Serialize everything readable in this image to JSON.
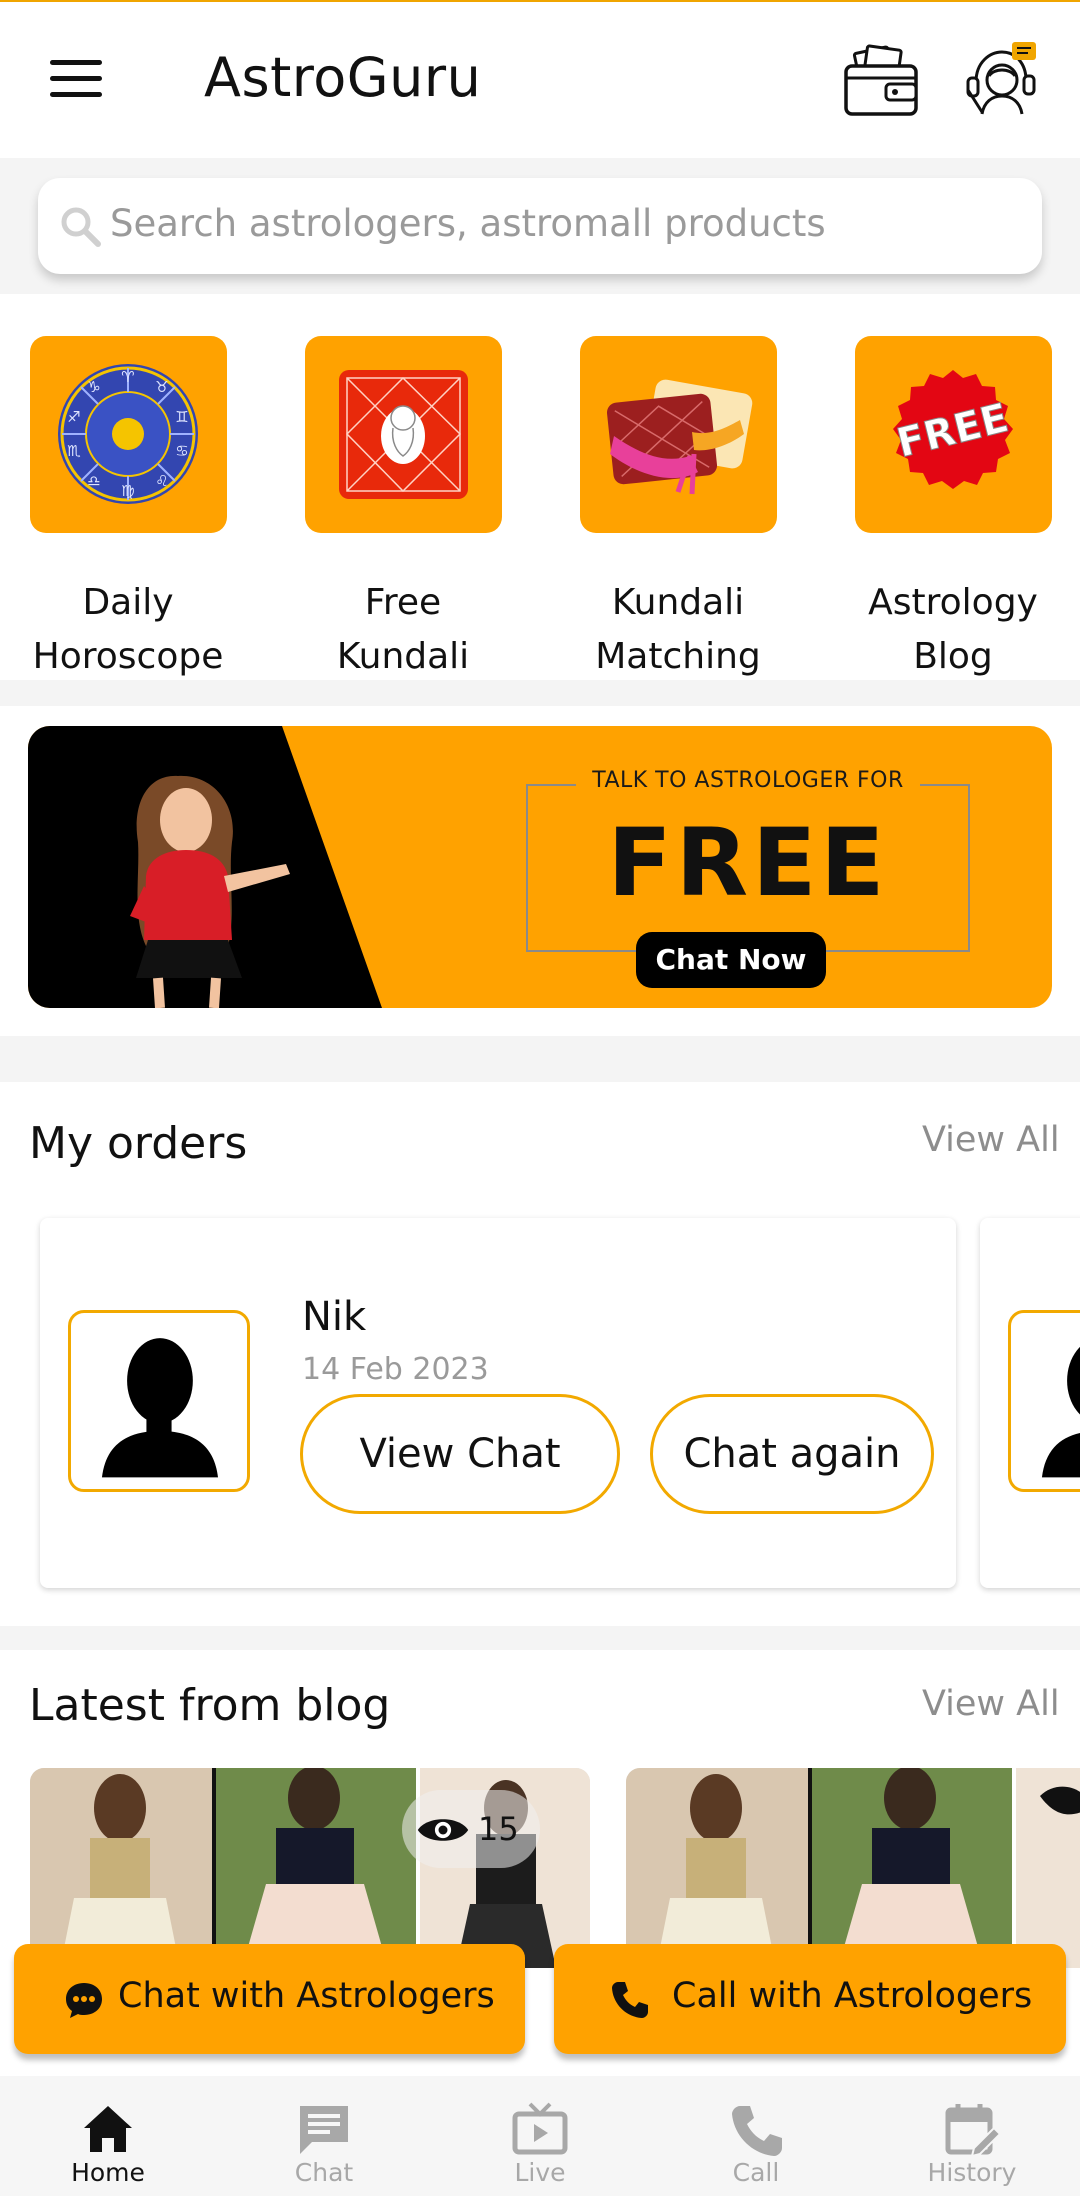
{
  "header": {
    "title": "AstroGuru"
  },
  "search": {
    "placeholder": "Search astrologers, astromall products"
  },
  "quick_links": [
    {
      "label_line1": "Daily",
      "label_line2": "Horoscope",
      "icon": "zodiac-wheel-icon"
    },
    {
      "label_line1": "Free",
      "label_line2": "Kundali",
      "icon": "kundali-chart-icon"
    },
    {
      "label_line1": "Kundali",
      "label_line2": "Matching",
      "icon": "kundali-matching-icon"
    },
    {
      "label_line1": "Astrology",
      "label_line2": "Blog",
      "icon": "free-badge-icon",
      "badge_text": "FREE"
    }
  ],
  "banner": {
    "subtitle": "TALK TO ASTROLOGER FOR",
    "headline": "FREE",
    "button_label": "Chat Now"
  },
  "orders": {
    "title": "My orders",
    "view_all": "View All",
    "items": [
      {
        "name": "Nik",
        "date": "14 Feb 2023",
        "primary_action": "View Chat",
        "secondary_action": "Chat again"
      }
    ]
  },
  "blog": {
    "title": "Latest from blog",
    "view_all": "View All",
    "posts": [
      {
        "views": "15"
      }
    ]
  },
  "actions": {
    "chat_label": "Chat with Astrologers",
    "call_label": "Call with Astrologers"
  },
  "bottom_nav": {
    "items": [
      {
        "label": "Home",
        "active": true
      },
      {
        "label": "Chat",
        "active": false
      },
      {
        "label": "Live",
        "active": false
      },
      {
        "label": "Call",
        "active": false
      },
      {
        "label": "History",
        "active": false
      }
    ]
  },
  "colors": {
    "accent": "#ffa200",
    "border_accent": "#f2a900",
    "muted_text": "#9a9a9a",
    "background_band": "#f4f4f4"
  }
}
